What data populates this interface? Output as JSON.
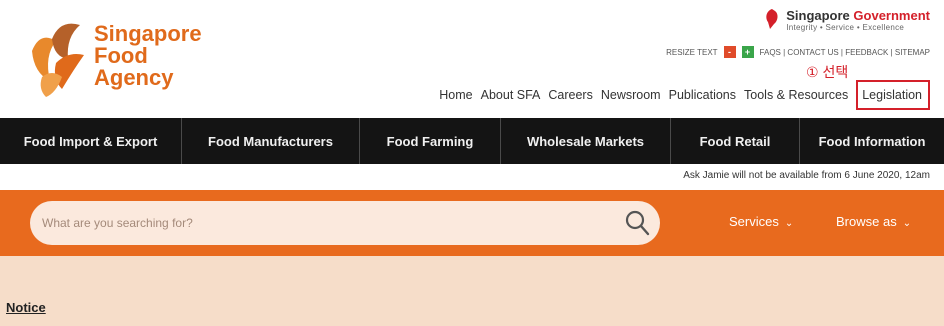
{
  "logo": {
    "line1": "Singapore",
    "line2": "Food",
    "line3": "Agency"
  },
  "government": {
    "title_part1": "Singapore",
    "title_part2": "Government",
    "motto": "Integrity • Service • Excellence"
  },
  "utility": {
    "resize_label": "RESIZE TEXT",
    "links": [
      "FAQS",
      "CONTACT US",
      "FEEDBACK",
      "SITEMAP"
    ]
  },
  "annotation": "① 선택",
  "topnav": [
    "Home",
    "About SFA",
    "Careers",
    "Newsroom",
    "Publications",
    "Tools & Resources",
    "Legislation"
  ],
  "categories": [
    "Food Import & Export",
    "Food Manufacturers",
    "Food Farming",
    "Wholesale Markets",
    "Food Retail",
    "Food Information"
  ],
  "notice_line": "Ask Jamie will not be available from 6 June 2020, 12am",
  "search": {
    "placeholder": "What are you searching for?"
  },
  "services_label": "Services",
  "browse_label": "Browse as",
  "notice_title": "Notice",
  "colors": {
    "brand_orange": "#e86a1e",
    "accent_red": "#d4202a",
    "catbar": "#141414",
    "peach": "#f6ddc9"
  }
}
